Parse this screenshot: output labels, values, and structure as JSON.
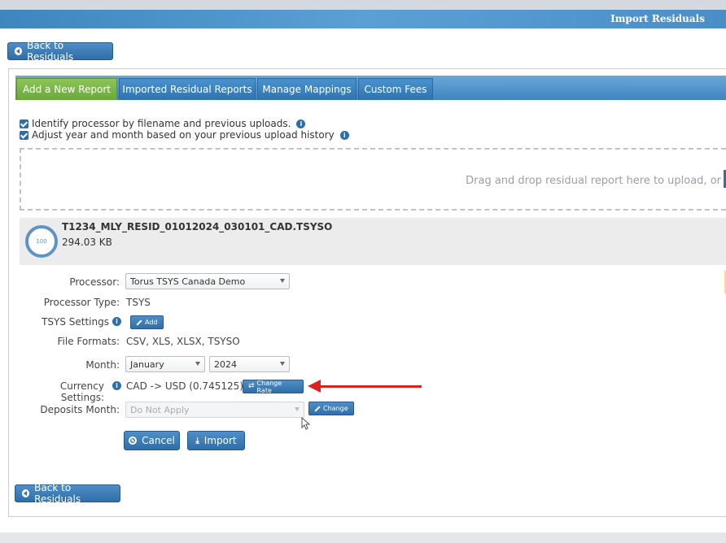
{
  "window": {
    "title": "Import Residuals"
  },
  "nav": {
    "back_label": "Back to Residuals"
  },
  "tabs": [
    {
      "label": "Add a New Report",
      "active": true
    },
    {
      "label": "Imported Residual Reports",
      "active": false
    },
    {
      "label": "Manage Mappings",
      "active": false
    },
    {
      "label": "Custom Fees",
      "active": false
    }
  ],
  "options": {
    "identify_processor": {
      "label": "Identify processor by filename and previous uploads.",
      "checked": true
    },
    "adjust_date": {
      "label": "Adjust year and month based on your previous upload history",
      "checked": true
    }
  },
  "dropzone": {
    "text": "Drag and drop residual report here to upload, or"
  },
  "file": {
    "name": "T1234_MLY_RESID_01012024_030101_CAD.TSYSO",
    "size": "294.03 KB",
    "progress": "100"
  },
  "form": {
    "processor_label": "Processor:",
    "processor_value": "Torus TSYS Canada Demo",
    "processor_type_label": "Processor Type:",
    "processor_type_value": "TSYS",
    "tsys_settings_label": "TSYS Settings",
    "add_label": "Add",
    "file_formats_label": "File Formats:",
    "file_formats_value": "CSV, XLS, XLSX, TSYSO",
    "month_label": "Month:",
    "month_value": "January",
    "year_value": "2024",
    "currency_label": "Currency Settings:",
    "currency_value": "CAD -> USD (0.745125)",
    "change_rate_label": "Change Rate",
    "deposits_month_label": "Deposits Month:",
    "deposits_month_value": "Do Not Apply",
    "change_label": "Change"
  },
  "actions": {
    "cancel_label": "Cancel",
    "import_label": "Import"
  },
  "colors": {
    "primary": "#2f6ea8",
    "active_tab": "#6aa83b",
    "annotation": "#e02020"
  },
  "icons": {
    "back": "circle-arrow-left-icon",
    "info": "info-icon",
    "pencil": "pencil-icon",
    "swap": "swap-arrows-icon",
    "cancel": "cancel-circle-icon",
    "import": "import-icon"
  }
}
